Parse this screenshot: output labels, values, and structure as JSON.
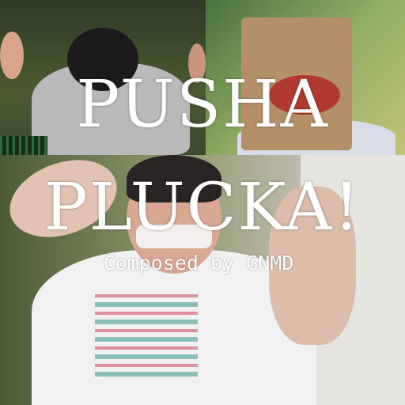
{
  "cover": {
    "title_line1": "PUSHA",
    "title_line2": "PLUCKA!",
    "credit": "Composed by GNMD"
  }
}
